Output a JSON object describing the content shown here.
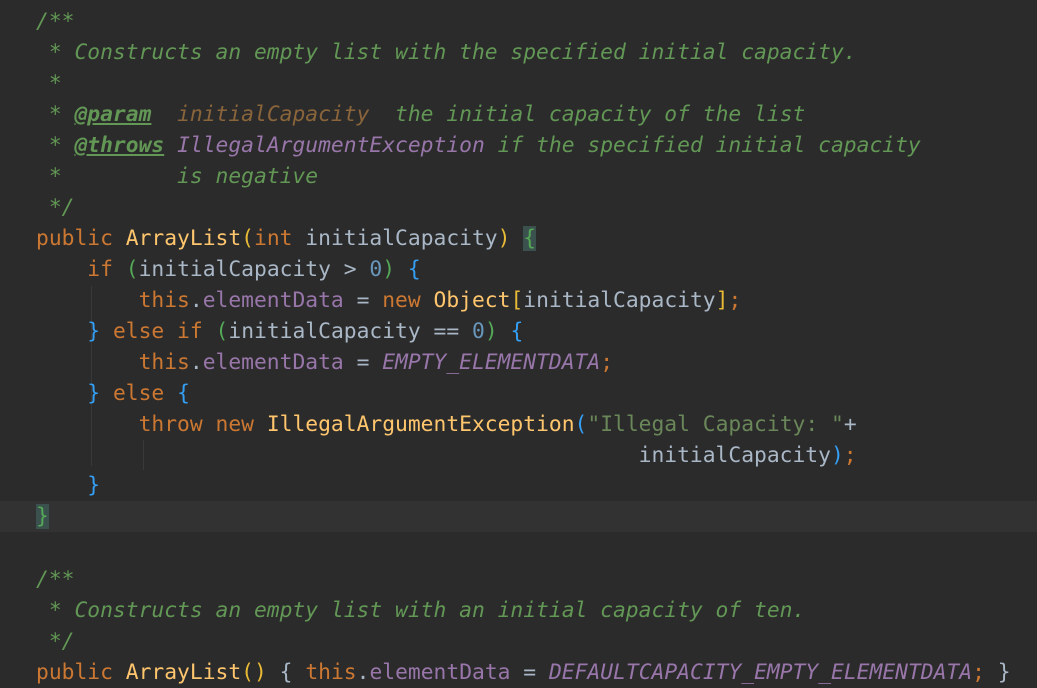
{
  "method1_doc": {
    "open": "/**",
    "summary": " * Constructs an empty list with the specified initial capacity.",
    "blank": " *",
    "param_prefix": " * ",
    "param_tag": "@param",
    "param_name": "initialCapacity",
    "param_desc": "  the initial capacity of the list",
    "throws_prefix": " * ",
    "throws_tag": "@throws",
    "throws_type": "IllegalArgumentException",
    "throws_desc": " if the specified initial capacity",
    "cont": " *         is negative",
    "close": " */"
  },
  "method1_code": {
    "modifier": "public",
    "name": "ArrayList",
    "ptype": "int",
    "pname": "initialCapacity",
    "if_kw": "if",
    "cond1_var": "initialCapacity",
    "gt": " > ",
    "zero1": "0",
    "this1": "this",
    "field1": "elementData",
    "assign1": " = ",
    "new1": "new",
    "obj": "Object",
    "arr_var": "initialCapacity",
    "else_if": "else if",
    "cond2_var": "initialCapacity",
    "eq": " == ",
    "zero2": "0",
    "this2": "this",
    "field2": "elementData",
    "assign2": " = ",
    "const1": "EMPTY_ELEMENTDATA",
    "else_kw": "else",
    "throw_kw": "throw",
    "new2": "new",
    "exc": "IllegalArgumentException",
    "msg": "\"Illegal Capacity: \"",
    "plus": "+",
    "cont_var": "initialCapacity"
  },
  "method2_doc": {
    "open": "/**",
    "summary": " * Constructs an empty list with an initial capacity of ten.",
    "close": " */"
  },
  "method2_code": {
    "modifier": "public",
    "name": "ArrayList",
    "this": "this",
    "field": "elementData",
    "assign": " = ",
    "const": "DEFAULTCAPACITY_EMPTY_ELEMENTDATA"
  }
}
